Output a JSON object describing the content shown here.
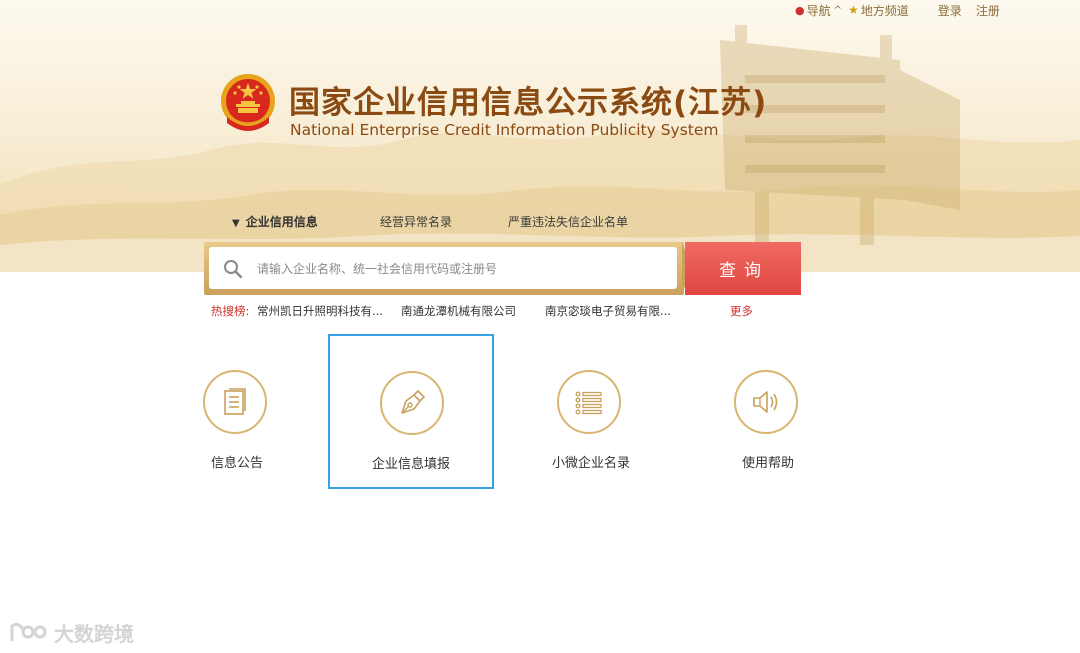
{
  "top_nav": {
    "navigation_label": "导航",
    "navigation_caret": "^",
    "local_channel_label": "地方频道",
    "login_label": "登录",
    "register_label": "注册"
  },
  "header": {
    "title_cn": "国家企业信用信息公示系统(江苏)",
    "title_en": "National Enterprise Credit Information Publicity System"
  },
  "tabs": [
    {
      "label": "企业信用信息",
      "active": true
    },
    {
      "label": "经营异常名录",
      "active": false
    },
    {
      "label": "严重违法失信企业名单",
      "active": false
    }
  ],
  "search": {
    "placeholder": "请输入企业名称、统一社会信用代码或注册号",
    "button_label": "查询"
  },
  "hot_search": {
    "label": "热搜榜:",
    "items": [
      "常州凯日升照明科技有...",
      "南通龙潭机械有限公司",
      "南京宓琰电子贸易有限..."
    ],
    "more_label": "更多"
  },
  "features": [
    {
      "label": "信息公告",
      "icon": "document-icon",
      "selected": false
    },
    {
      "label": "企业信息填报",
      "icon": "pen-nib-icon",
      "selected": true
    },
    {
      "label": "小微企业名录",
      "icon": "list-icon",
      "selected": false
    },
    {
      "label": "使用帮助",
      "icon": "speaker-icon",
      "selected": false
    }
  ],
  "watermark": {
    "text": "大数跨境"
  },
  "colors": {
    "brand_brown": "#8b4a12",
    "gold": "#d8b570",
    "search_button_red": "#e04640",
    "hot_red": "#d0302e",
    "selected_border_blue": "#3aa0e6"
  }
}
